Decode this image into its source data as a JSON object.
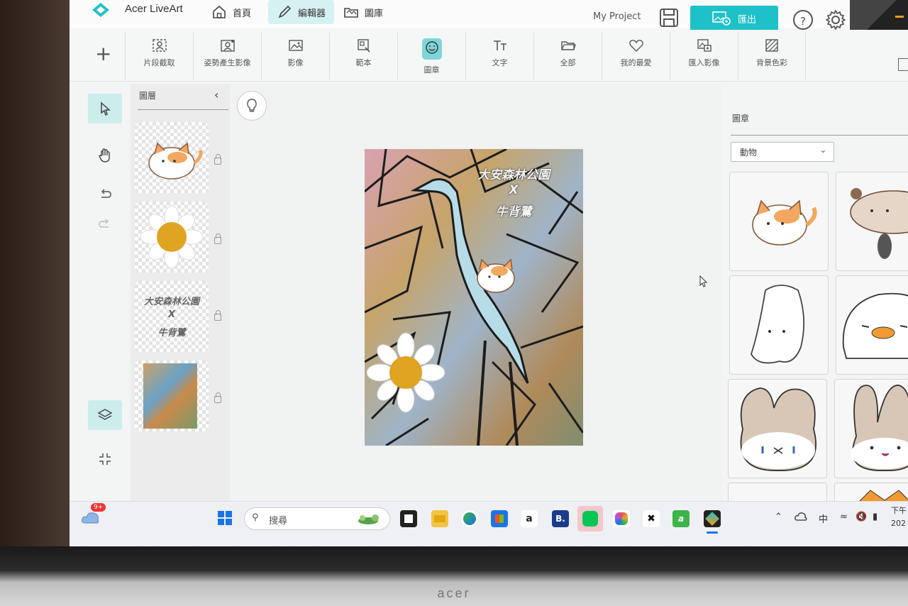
{
  "app": {
    "name": "Acer LiveArt"
  },
  "nav": {
    "home": "首頁",
    "editor": "編輯器",
    "gallery": "圖庫"
  },
  "header": {
    "project": "My Project",
    "export": "匯出",
    "help": "?"
  },
  "toolbar": {
    "tools": [
      "片段截取",
      "姿勢產生影像",
      "影像",
      "範本",
      "圖章",
      "文字",
      "全部",
      "我的最愛",
      "匯入影像",
      "背景色彩"
    ],
    "active": "圖章"
  },
  "layers": {
    "title": "圖層",
    "text_layer": [
      "大安森林公園",
      "X",
      "牛背鷺"
    ]
  },
  "canvas": {
    "art_text": [
      "大安森林公園",
      "X",
      "牛背鷺"
    ]
  },
  "stickers": {
    "title": "圖章",
    "category": "動物"
  },
  "taskbar": {
    "search": "搜尋",
    "badge": "9+",
    "ime": "中",
    "time_partial": "下午",
    "date_partial": "202",
    "booking": "B."
  },
  "colors": {
    "accent": "#1ec1c8",
    "active_bg": "#d6f1f1"
  }
}
